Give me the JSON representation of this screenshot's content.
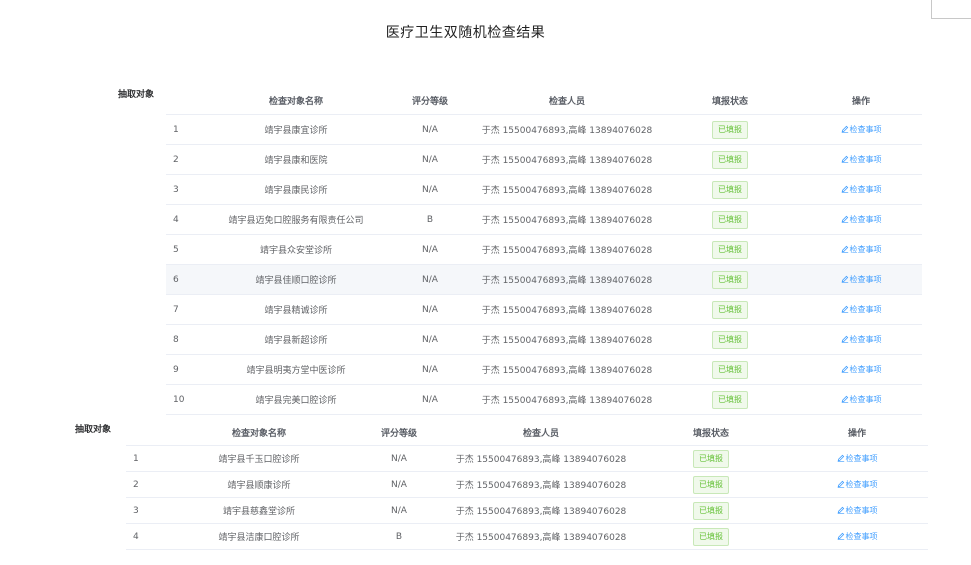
{
  "title": "医疗卫生双随机检查结果",
  "sections": [
    {
      "label": "抽取对象",
      "headers": [
        "",
        "检查对象名称",
        "评分等级",
        "检查人员",
        "填报状态",
        "操作"
      ],
      "rows": [
        {
          "idx": "1",
          "name": "靖宇县康宜诊所",
          "grade": "N/A",
          "inspectors": "于杰 15500476893,高峰 13894076028",
          "status": "已填报",
          "action": "检查事项"
        },
        {
          "idx": "2",
          "name": "靖宇县康和医院",
          "grade": "N/A",
          "inspectors": "于杰 15500476893,高峰 13894076028",
          "status": "已填报",
          "action": "检查事项"
        },
        {
          "idx": "3",
          "name": "靖宇县康民诊所",
          "grade": "N/A",
          "inspectors": "于杰 15500476893,高峰 13894076028",
          "status": "已填报",
          "action": "检查事项"
        },
        {
          "idx": "4",
          "name": "靖宇县迈免口腔服务有限责任公司",
          "grade": "B",
          "inspectors": "于杰 15500476893,高峰 13894076028",
          "status": "已填报",
          "action": "检查事项"
        },
        {
          "idx": "5",
          "name": "靖宇县众安堂诊所",
          "grade": "N/A",
          "inspectors": "于杰 15500476893,高峰 13894076028",
          "status": "已填报",
          "action": "检查事项"
        },
        {
          "idx": "6",
          "name": "靖宇县佳顺口腔诊所",
          "grade": "N/A",
          "inspectors": "于杰 15500476893,高峰 13894076028",
          "status": "已填报",
          "action": "检查事项"
        },
        {
          "idx": "7",
          "name": "靖宇县精诚诊所",
          "grade": "N/A",
          "inspectors": "于杰 15500476893,高峰 13894076028",
          "status": "已填报",
          "action": "检查事项"
        },
        {
          "idx": "8",
          "name": "靖宇县新超诊所",
          "grade": "N/A",
          "inspectors": "于杰 15500476893,高峰 13894076028",
          "status": "已填报",
          "action": "检查事项"
        },
        {
          "idx": "9",
          "name": "靖宇县明夷方堂中医诊所",
          "grade": "N/A",
          "inspectors": "于杰 15500476893,高峰 13894076028",
          "status": "已填报",
          "action": "检查事项"
        },
        {
          "idx": "10",
          "name": "靖宇县完美口腔诊所",
          "grade": "N/A",
          "inspectors": "于杰 15500476893,高峰 13894076028",
          "status": "已填报",
          "action": "检查事项"
        }
      ]
    },
    {
      "label": "抽取对象",
      "headers": [
        "",
        "检查对象名称",
        "评分等级",
        "检查人员",
        "填报状态",
        "操作"
      ],
      "rows": [
        {
          "idx": "1",
          "name": "靖宇县千玉口腔诊所",
          "grade": "N/A",
          "inspectors": "于杰 15500476893,高峰 13894076028",
          "status": "已填报",
          "action": "检查事项"
        },
        {
          "idx": "2",
          "name": "靖宇县顺康诊所",
          "grade": "N/A",
          "inspectors": "于杰 15500476893,高峰 13894076028",
          "status": "已填报",
          "action": "检查事项"
        },
        {
          "idx": "3",
          "name": "靖宇县慈鑫堂诊所",
          "grade": "N/A",
          "inspectors": "于杰 15500476893,高峰 13894076028",
          "status": "已填报",
          "action": "检查事项"
        },
        {
          "idx": "4",
          "name": "靖宇县洁康口腔诊所",
          "grade": "B",
          "inspectors": "于杰 15500476893,高峰 13894076028",
          "status": "已填报",
          "action": "检查事项"
        }
      ]
    }
  ],
  "colors": {
    "accent": "#409eff",
    "status_green": "#67c23a",
    "status_bg": "#f0f9eb",
    "row_hover": "#f5f7fa"
  }
}
